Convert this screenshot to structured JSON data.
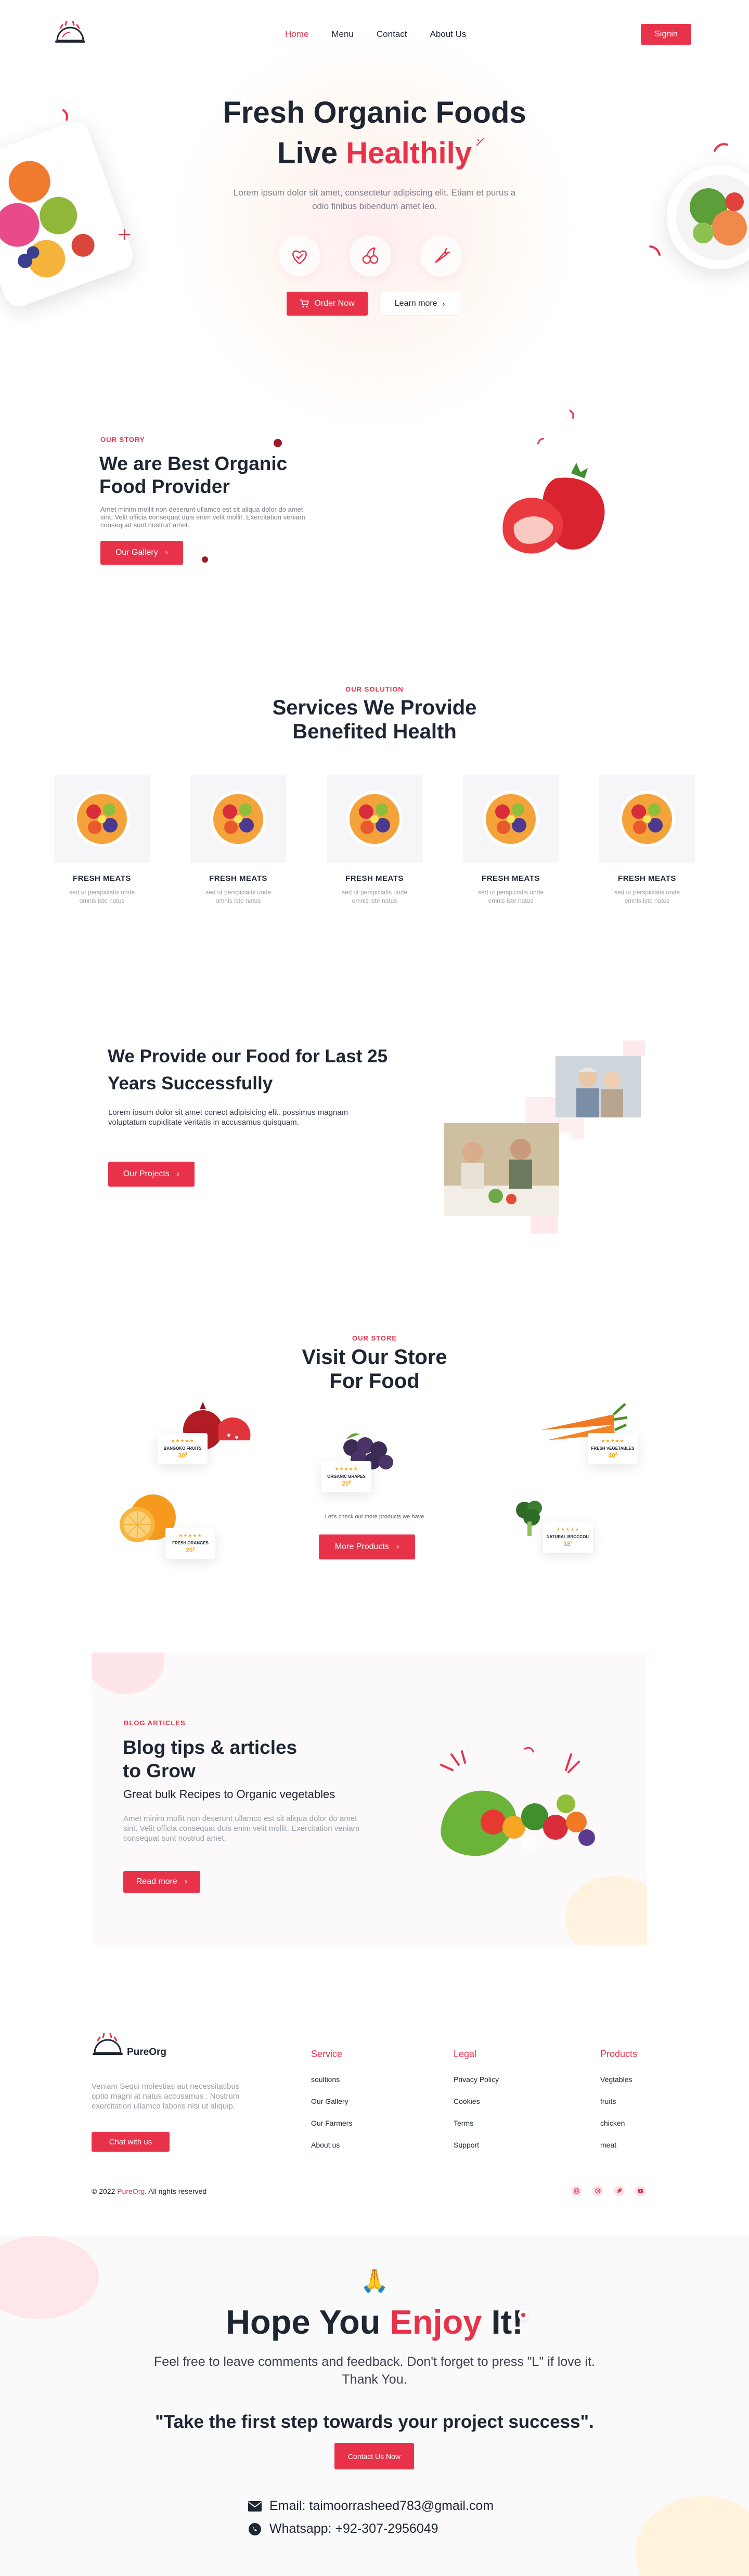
{
  "nav": {
    "links": [
      "Home",
      "Menu",
      "Contact",
      "About Us"
    ],
    "signin": "Signin"
  },
  "hero": {
    "title_line1": "Fresh Organic Foods",
    "title_line2_a": "Live ",
    "title_line2_b": "Healthily",
    "subtitle": "Lorem ipsum dolor sit amet, consectetur adipiscing elit. Etiam et purus a odio finibus bibendum amet leo.",
    "order_label": "Order Now",
    "learn_label": "Learn more"
  },
  "story": {
    "eyebrow": "OUR STORY",
    "title": "We are Best Organic Food Provider",
    "text": "Amet minim mollit non deserunt ullamco est sit aliqua dolor do amet sint. Velit officia consequat duis enim velit mollit. Exercitation veniam consequat sunt nostrud amet.",
    "button": "Our Gallery"
  },
  "services": {
    "eyebrow": "OUR SOLUTION",
    "title_line1": "Services We Provide",
    "title_line2": "Benefited Health",
    "items": [
      {
        "name": "FRESH MEATS",
        "desc": "sed ut perspiciatis unde omnis iste natus"
      },
      {
        "name": "FRESH MEATS",
        "desc": "sed ut perspiciatis unde omnis iste natus"
      },
      {
        "name": "FRESH MEATS",
        "desc": "sed ut perspiciatis unde omnis iste natus"
      },
      {
        "name": "FRESH MEATS",
        "desc": "sed ut perspiciatis unde omnis iste natus"
      },
      {
        "name": "FRESH MEATS",
        "desc": "sed ut perspiciatis unde omnis iste natus"
      }
    ]
  },
  "years": {
    "title": "We Provide our Food for Last 25 Years Successfully",
    "text": "Lorem ipsum dolor sit amet conect adipisicing elit. possimus magnam voluptatum cupiditate veritatis in accusamus quisquam.",
    "button": "Our Projects"
  },
  "store": {
    "eyebrow": "OUR STORE",
    "title_line1": "Visit Our Store",
    "title_line2": "For Food",
    "products": [
      {
        "name": "BANGOKO FRUITS",
        "stars": "★★★★★",
        "price": "30",
        "currency": "$"
      },
      {
        "name": "ORGANIC GRAPES",
        "stars": "★★★★★",
        "price": "20",
        "currency": "$"
      },
      {
        "name": "FRESH VEGETABLES",
        "stars": "★★★★★",
        "price": "40",
        "currency": "$"
      },
      {
        "name": "FRESH ORANGES",
        "stars": "★★★★★",
        "price": "25",
        "currency": "$"
      },
      {
        "name": "NATURAL BROCCOLI",
        "stars": "★★★★★",
        "price": "18",
        "currency": "$"
      }
    ],
    "desc": "Let's check out more products we have",
    "button": "More Products"
  },
  "blog": {
    "eyebrow": "BLOG ARTICLES",
    "title_line1": "Blog tips & articles",
    "title_line2": "to Grow",
    "subtitle": "Great bulk Recipes to Organic vegetables",
    "text": "Amet minim mollit non deserunt ullamco est sit aliqua dolor do amet sint. Velit officia consequat duis enim velit mollit. Exercitation veniam consequat sunt nostrud amet.",
    "button": "Read more"
  },
  "footer": {
    "brand": "PureOrg",
    "text": "Veniam Sequi molestias aut necessitatibus optio magni at natus accusamus . Nostrum exercitation ullamco laboris nisi ut aliquip.",
    "chat": "Chat with us",
    "columns": [
      {
        "title": "Service",
        "links": [
          "soultions",
          "Our Gallery",
          "Our Farmers",
          "About us"
        ]
      },
      {
        "title": "Legal",
        "links": [
          "Privacy Policy",
          "Cookies",
          "Terms",
          "Support"
        ]
      },
      {
        "title": "Products",
        "links": [
          "Vegtables",
          "fruits",
          "chicken",
          "meat"
        ]
      }
    ],
    "copyright_a": "© 2022 ",
    "copyright_brand": "PureOrg",
    "copyright_b": ". All rights reserved"
  },
  "thanks": {
    "emoji": "🙏",
    "title_a": "Hope You ",
    "title_b": "Enjoy",
    "title_c": " It!",
    "text": "Feel free to leave comments and feedback. Don't forget to press  \"L\" if love it. Thank You.",
    "quote": "\"Take the first step towards your project success\".",
    "button": "Contact Us Now",
    "email": "Email: taimoorrasheed783@gmail.com",
    "whatsapp": "Whatsapp: +92-307-2956049"
  },
  "colors": {
    "accent": "#e8324a",
    "dark": "#1e2533",
    "star": "#f5a623"
  }
}
